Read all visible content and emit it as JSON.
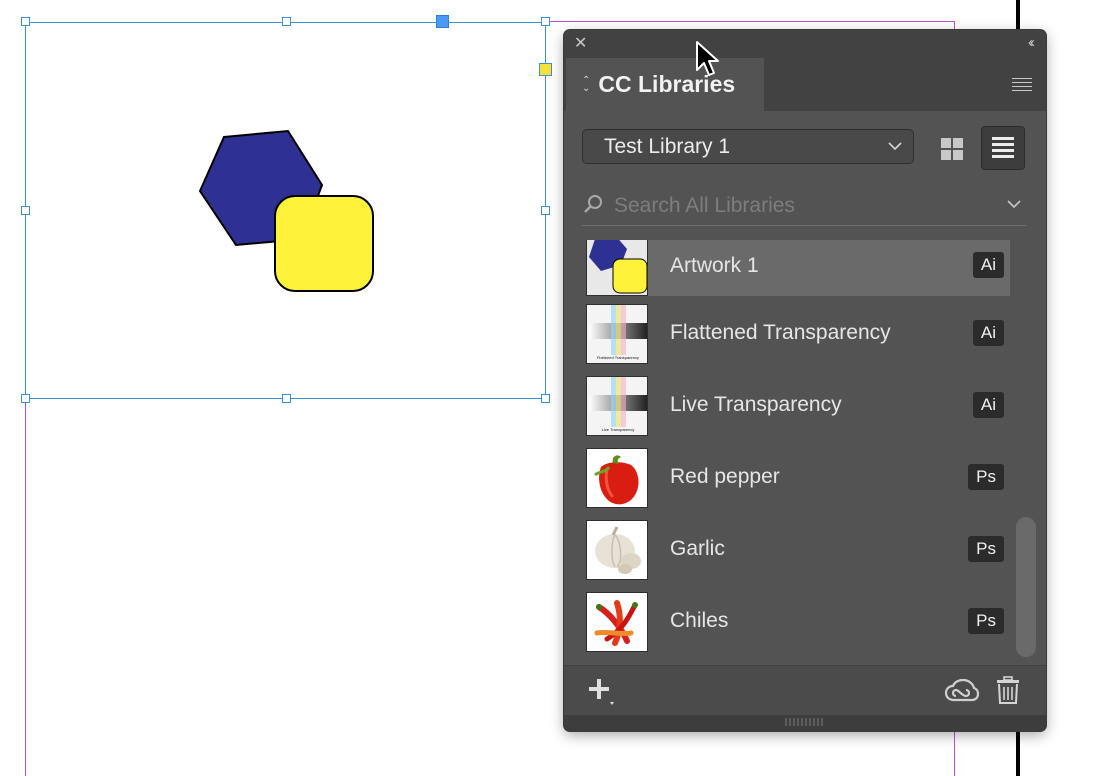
{
  "panel": {
    "title": "CC Libraries",
    "library": "Test Library 1",
    "search_placeholder": "Search All Libraries",
    "items": [
      {
        "name": "Artwork 1",
        "badge": "Ai",
        "selected": true,
        "thumb": "artwork-thumbnail"
      },
      {
        "name": "Flattened Transparency",
        "badge": "Ai",
        "selected": false,
        "thumb": "flattened-transparency-thumbnail",
        "thumb_caption": "Flattened Transparency"
      },
      {
        "name": "Live Transparency",
        "badge": "Ai",
        "selected": false,
        "thumb": "live-transparency-thumbnail",
        "thumb_caption": "Live Transparency"
      },
      {
        "name": "Red pepper",
        "badge": "Ps",
        "selected": false,
        "thumb": "red-pepper-thumbnail"
      },
      {
        "name": "Garlic",
        "badge": "Ps",
        "selected": false,
        "thumb": "garlic-thumbnail"
      },
      {
        "name": "Chiles",
        "badge": "Ps",
        "selected": false,
        "thumb": "chiles-thumbnail"
      }
    ],
    "icons": [
      "close-icon",
      "collapse-icon",
      "panel-menu-icon",
      "grid-view-icon",
      "list-view-icon",
      "search-icon",
      "chevron-down-icon",
      "add-icon",
      "creative-cloud-sync-icon",
      "trash-icon"
    ]
  },
  "colors": {
    "panel_bg": "#535353",
    "panel_header": "#424242",
    "selected_row": "#6a6a6a",
    "frame_border": "#3d8fd6",
    "margin_guide": "#c050d0",
    "hexagon": "#2f3192",
    "rounded_square": "#fff23a"
  }
}
